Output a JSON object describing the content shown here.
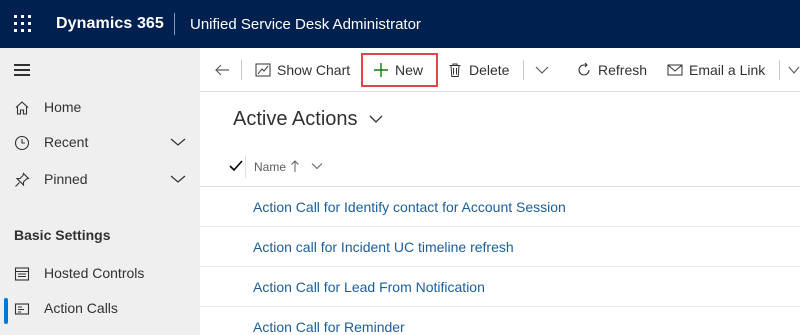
{
  "topbar": {
    "brand": "Dynamics 365",
    "app_name": "Unified Service Desk Administrator"
  },
  "sidebar": {
    "items": [
      {
        "label": "Home",
        "icon": "home-icon"
      },
      {
        "label": "Recent",
        "icon": "clock-icon"
      },
      {
        "label": "Pinned",
        "icon": "pin-icon"
      }
    ],
    "section_title": "Basic Settings",
    "section_items": [
      {
        "label": "Hosted Controls",
        "icon": "hosted-controls-icon"
      },
      {
        "label": "Action Calls",
        "icon": "action-calls-icon",
        "selected": true
      }
    ]
  },
  "commands": {
    "back": "back-arrow-icon",
    "show_chart": "Show Chart",
    "new": "New",
    "delete": "Delete",
    "refresh": "Refresh",
    "email_link": "Email a Link"
  },
  "view": {
    "title": "Active Actions",
    "column_name": "Name",
    "rows": [
      "Action Call for Identify contact for Account Session",
      "Action call for Incident UC timeline refresh",
      "Action Call for Lead From Notification",
      "Action Call for Reminder"
    ]
  },
  "colors": {
    "topbar": "#002050",
    "sidebar": "#efefef",
    "accent": "#0078d4",
    "link": "#1b5e9b",
    "highlight": "#e0454a",
    "new_icon": "#107c10"
  }
}
